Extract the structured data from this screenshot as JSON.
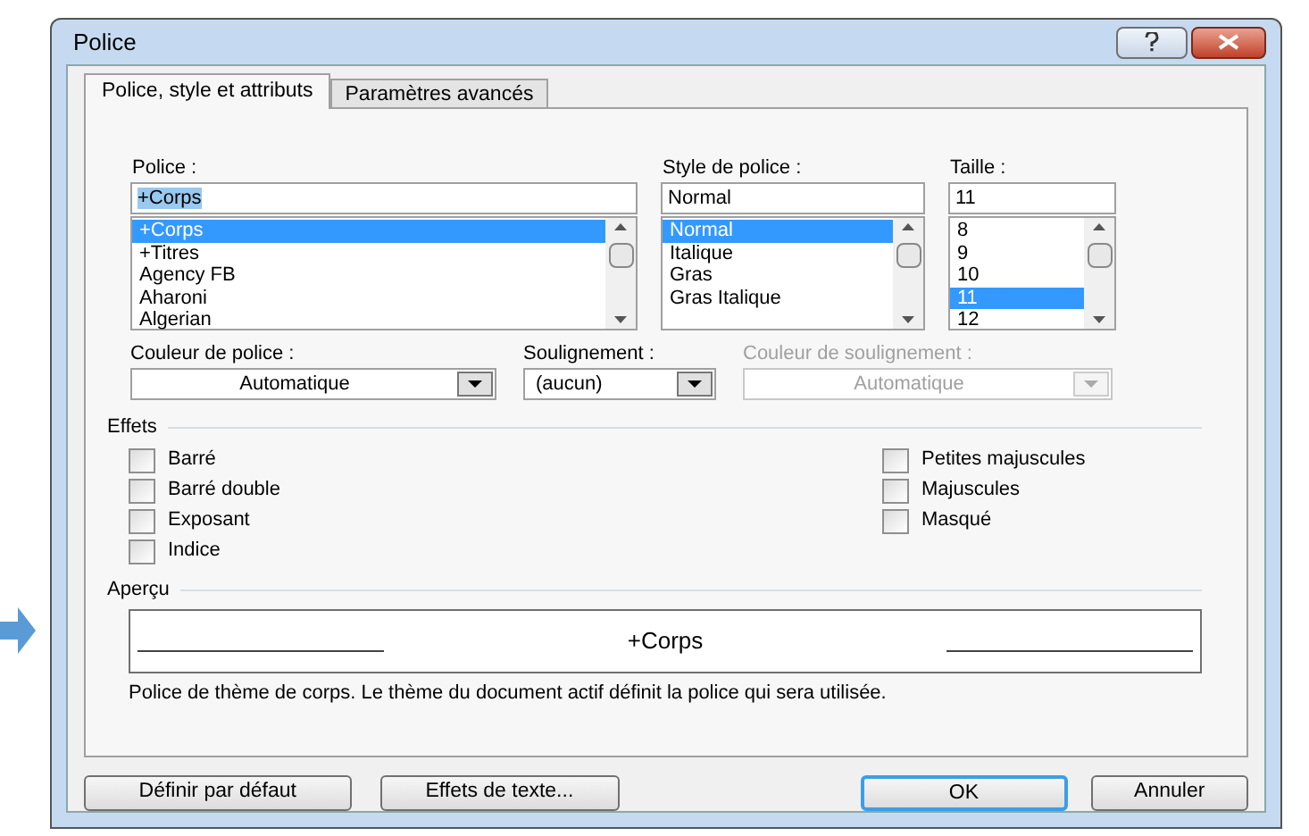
{
  "window": {
    "title": "Police"
  },
  "tabs": [
    {
      "label": "Police, style et attributs",
      "selected": true
    },
    {
      "label": "Paramètres avancés",
      "selected": false
    }
  ],
  "lists": [
    {
      "label": "Police :",
      "value": "+Corps",
      "items": [
        {
          "label": "+Corps",
          "selected": true
        },
        {
          "label": "+Titres",
          "selected": false
        },
        {
          "label": "Agency FB",
          "selected": false
        },
        {
          "label": "Aharoni",
          "selected": false
        },
        {
          "label": "Algerian",
          "selected": false
        }
      ]
    },
    {
      "label": "Style de police :",
      "value": "Normal",
      "items": [
        {
          "label": "Normal",
          "selected": true
        },
        {
          "label": "Italique",
          "selected": false
        },
        {
          "label": "Gras",
          "selected": false
        },
        {
          "label": "Gras Italique",
          "selected": false
        }
      ]
    },
    {
      "label": "Taille :",
      "value": "11",
      "items": [
        {
          "label": "8",
          "selected": false
        },
        {
          "label": "9",
          "selected": false
        },
        {
          "label": "10",
          "selected": false
        },
        {
          "label": "11",
          "selected": true
        },
        {
          "label": "12",
          "selected": false
        }
      ]
    }
  ],
  "dropdowns": [
    {
      "label": "Couleur de police :",
      "value": "Automatique",
      "disabled": false
    },
    {
      "label": "Soulignement :",
      "value": "(aucun)",
      "disabled": false
    },
    {
      "label": "Couleur de soulignement :",
      "value": "Automatique",
      "disabled": true
    }
  ],
  "effects": {
    "title": "Effets",
    "left": [
      {
        "label": "Barré",
        "checked": false
      },
      {
        "label": "Barré double",
        "checked": false
      },
      {
        "label": "Exposant",
        "checked": false
      },
      {
        "label": "Indice",
        "checked": false
      }
    ],
    "right": [
      {
        "label": "Petites majuscules",
        "checked": false
      },
      {
        "label": "Majuscules",
        "checked": false
      },
      {
        "label": "Masqué",
        "checked": false
      }
    ]
  },
  "preview": {
    "title": "Aperçu",
    "sample": "+Corps",
    "description": "Police de thème de corps. Le thème du document actif définit la police qui sera utilisée."
  },
  "buttons": [
    {
      "label": "Définir par défaut",
      "default": false
    },
    {
      "label": "Effets de texte...",
      "default": false
    },
    {
      "label": "OK",
      "default": true
    },
    {
      "label": "Annuler",
      "default": false
    }
  ]
}
